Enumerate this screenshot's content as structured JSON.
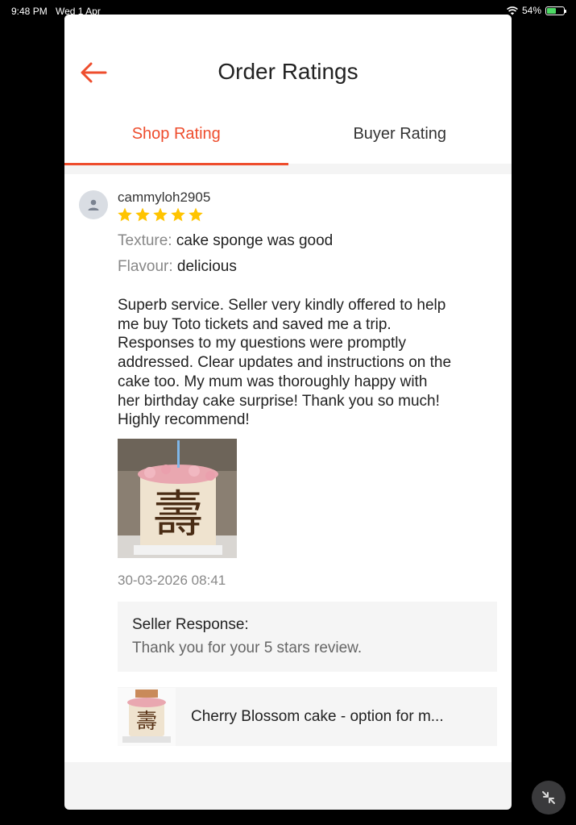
{
  "status_bar": {
    "time": "9:48 PM",
    "date": "Wed 1 Apr",
    "battery": "54%"
  },
  "header": {
    "title": "Order Ratings"
  },
  "tabs": [
    {
      "label": "Shop Rating",
      "active": true
    },
    {
      "label": "Buyer Rating",
      "active": false
    }
  ],
  "review": {
    "username": "cammyloh2905",
    "stars": 5,
    "attributes": [
      {
        "label": "Texture:",
        "value": "cake sponge was good"
      },
      {
        "label": "Flavour:",
        "value": "delicious"
      }
    ],
    "comment_lines": [
      "Superb service. Seller very kindly offered to help",
      "me buy Toto tickets and saved me a trip.",
      "Responses to my questions were promptly",
      "addressed. Clear updates and instructions on the",
      "cake too. My mum was thoroughly happy with",
      "her birthday cake surprise! Thank you so much!",
      "Highly recommend!"
    ],
    "photo_text": "壽",
    "timestamp": "30-03-2026 08:41",
    "seller_response": {
      "title": "Seller Response:",
      "text": "Thank you for your 5 stars review."
    },
    "product": {
      "name": "Cherry Blossom cake - option for m..."
    }
  },
  "colors": {
    "accent": "#ee4d2d",
    "star": "#ffc400"
  },
  "icons": {
    "back": "arrow-left-icon",
    "avatar": "user-icon",
    "minimize": "minimize-icon"
  }
}
